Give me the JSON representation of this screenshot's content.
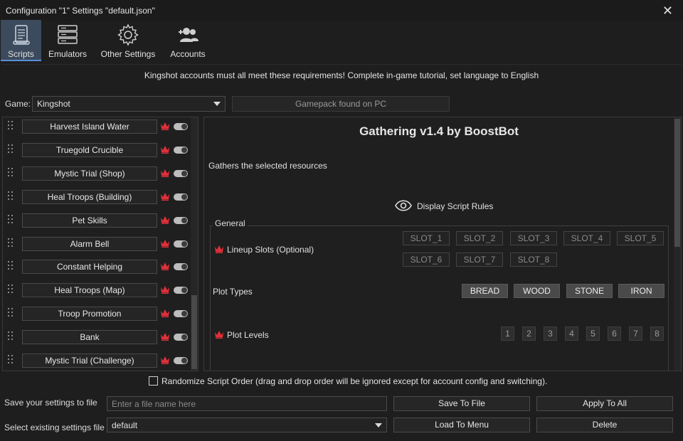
{
  "window": {
    "title": "Configuration \"1\" Settings \"default.json\""
  },
  "toolbar": {
    "items": [
      {
        "label": "Scripts",
        "icon": "scroll-icon",
        "active": true
      },
      {
        "label": "Emulators",
        "icon": "server-icon"
      },
      {
        "label": "Other Settings",
        "icon": "gear-icon"
      },
      {
        "label": "Accounts",
        "icon": "add-user-icon"
      }
    ]
  },
  "banner": "Kingshot accounts must all meet these requirements! Complete in-game tutorial, set language to English",
  "game": {
    "label": "Game:",
    "value": "Kingshot",
    "gamepack": "Gamepack found on PC"
  },
  "scripts": [
    "Harvest Island Water",
    "Truegold Crucible",
    "Mystic Trial (Shop)",
    "Heal Troops (Building)",
    "Pet Skills",
    "Alarm Bell",
    "Constant Helping",
    "Heal Troops (Map)",
    "Troop Promotion",
    "Bank",
    "Mystic Trial (Challenge)"
  ],
  "detail": {
    "title": "Gathering v1.4 by BoostBot",
    "description": "Gathers the selected resources",
    "rules_label": "Display Script Rules",
    "group_label": "General",
    "lineup_label": "Lineup Slots (Optional)",
    "slots": [
      "SLOT_1",
      "SLOT_2",
      "SLOT_3",
      "SLOT_4",
      "SLOT_5",
      "SLOT_6",
      "SLOT_7",
      "SLOT_8"
    ],
    "plot_types_label": "Plot Types",
    "plot_types": [
      "BREAD",
      "WOOD",
      "STONE",
      "IRON"
    ],
    "plot_levels_label": "Plot Levels",
    "plot_levels": [
      "1",
      "2",
      "3",
      "4",
      "5",
      "6",
      "7",
      "8"
    ]
  },
  "randomize": {
    "label": "Randomize Script Order (drag and drop order will be ignored except for account config and switching).",
    "checked": false
  },
  "footer": {
    "save_label": "Save your settings to file",
    "file_placeholder": "Enter a file name here",
    "select_label": "Select existing settings file",
    "select_value": "default",
    "save_button": "Save To File",
    "apply_button": "Apply To All",
    "load_button": "Load To Menu",
    "delete_button": "Delete"
  },
  "colors": {
    "accent": "#5a8fd8",
    "crown": "#e0303a",
    "active_tab": "#3b4a5c"
  }
}
